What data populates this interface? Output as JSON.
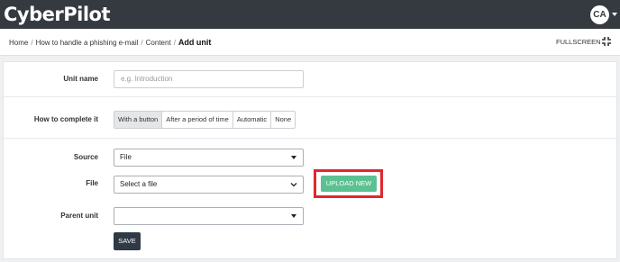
{
  "app": {
    "logo_text": "CyberPilot"
  },
  "header": {
    "avatar_initials": "CA",
    "brand_color": "#343a40"
  },
  "breadcrumb": [
    {
      "label": "Home"
    },
    {
      "label": "How to handle a phishing e-mail"
    },
    {
      "label": "Content"
    },
    {
      "label": "Add unit"
    }
  ],
  "breadcrumb_sep": "/",
  "toolbar": {
    "fullscreen_label": "FULLSCREEN",
    "fullscreen_icon": "expand-icon"
  },
  "form": {
    "unit_name": {
      "label": "Unit name",
      "placeholder": "e.g. Introduction",
      "value": ""
    },
    "completion": {
      "label": "How to complete it",
      "options": [
        "With a button",
        "After a period of time",
        "Automatic",
        "None"
      ],
      "selected": "With a button"
    },
    "source": {
      "label": "Source",
      "value": "File"
    },
    "file": {
      "label": "File",
      "value": "Select a file"
    },
    "upload_button": {
      "label": "UPLOAD NEW",
      "color": "#5cc192",
      "highlight_color": "#e0282e"
    },
    "parent_unit": {
      "label": "Parent unit",
      "value": ""
    },
    "save_button": {
      "label": "SAVE",
      "color": "#2f3a45"
    }
  }
}
